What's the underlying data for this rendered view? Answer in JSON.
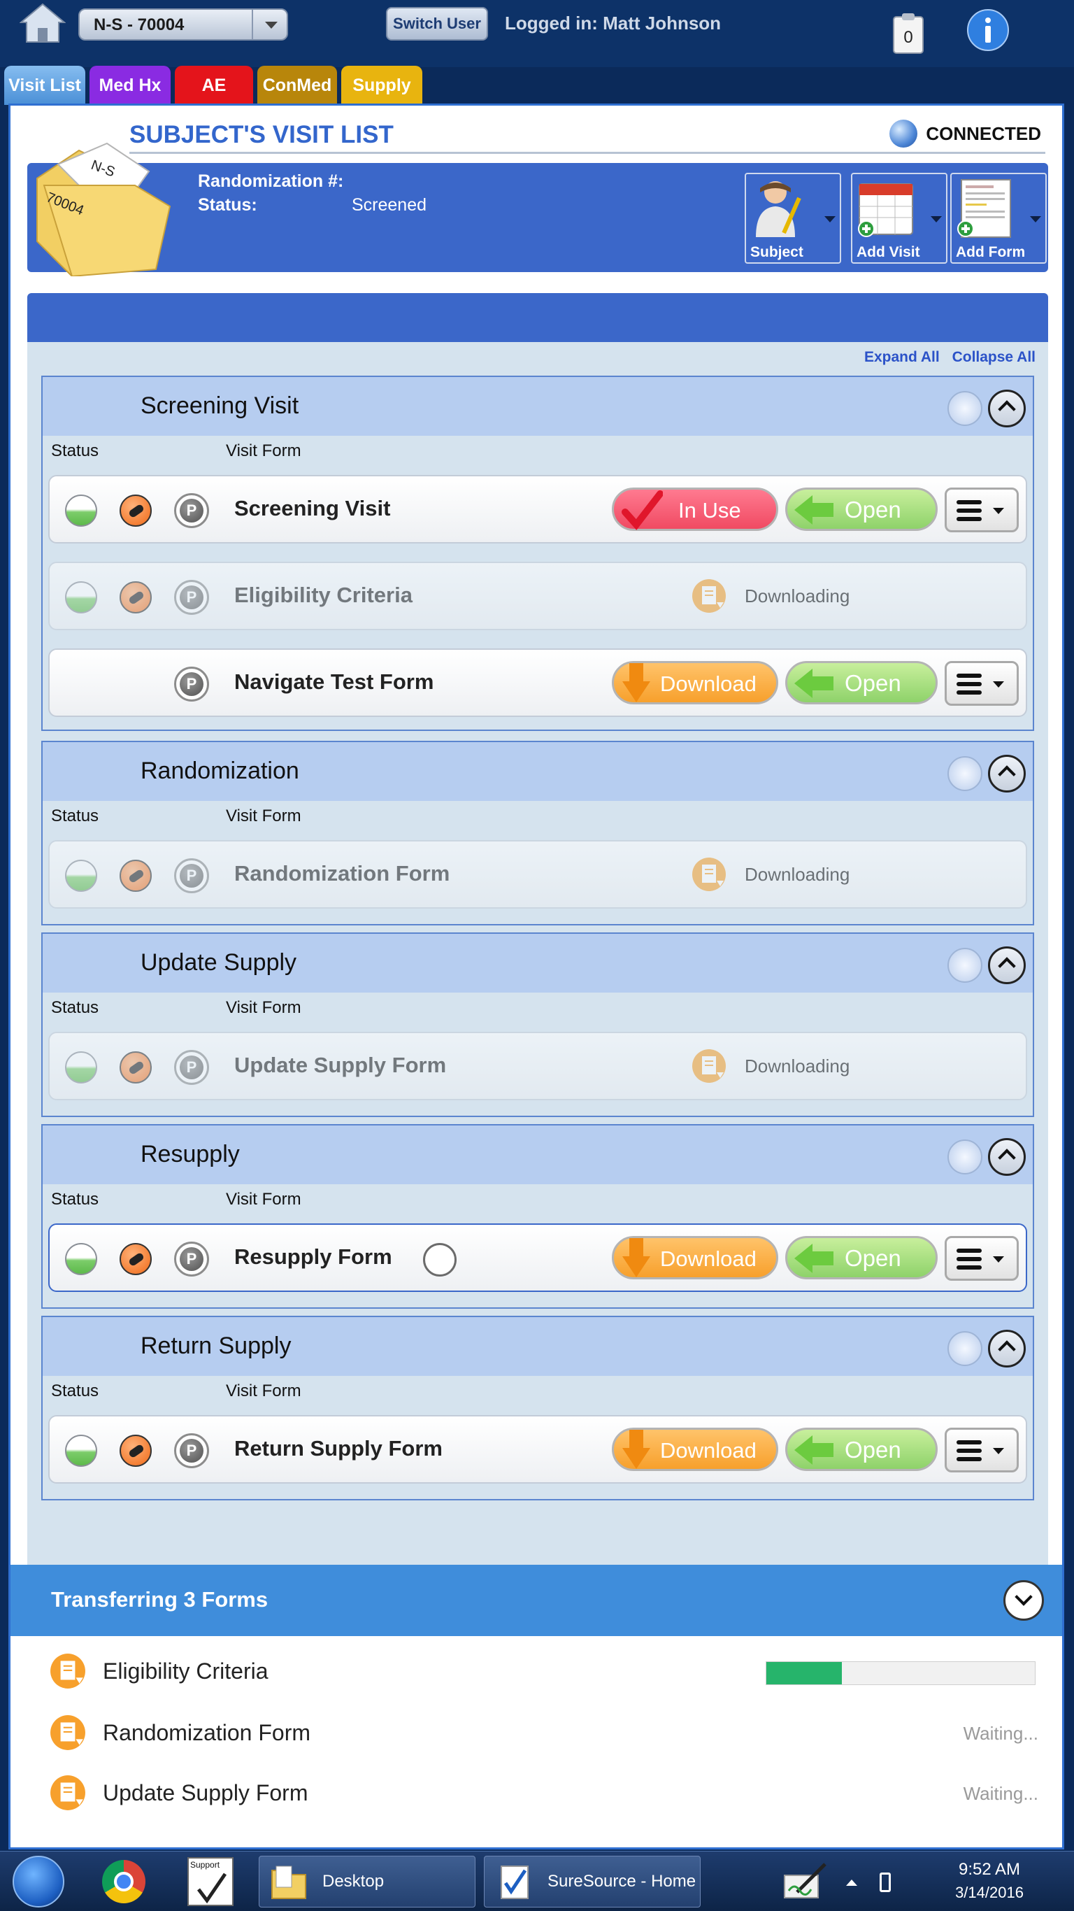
{
  "topbar": {
    "subject_id": "N-S - 70004",
    "switch_user_label": "Switch User",
    "logged_in_text": "Logged in: Matt Johnson",
    "clipboard_count": "0"
  },
  "tabs": [
    {
      "label": "Visit List"
    },
    {
      "label": "Med Hx"
    },
    {
      "label": "AE"
    },
    {
      "label": "ConMed"
    },
    {
      "label": "Supply"
    }
  ],
  "header": {
    "title": "SUBJECT'S VISIT LIST",
    "connection_status": "CONNECTED",
    "folder_label_1": "N-S",
    "folder_label_2": "70004",
    "randomization_label": "Randomization #:",
    "randomization_value": "",
    "status_label": "Status:",
    "status_value": "Screened",
    "toolbar": {
      "subject_label": "Subject",
      "add_visit_label": "Add Visit",
      "add_form_label": "Add Form"
    }
  },
  "list": {
    "expand_all": "Expand All",
    "collapse_all": "Collapse All",
    "col_status": "Status",
    "col_visit_form": "Visit Form",
    "groups": [
      {
        "title": "Screening Visit",
        "forms": [
          {
            "name": "Screening Visit",
            "state": "in-use",
            "action_label": "In Use",
            "open_label": "Open"
          },
          {
            "name": "Eligibility Criteria",
            "state": "downloading",
            "downloading_label": "Downloading"
          },
          {
            "name": "Navigate Test Form",
            "state": "download",
            "action_label": "Download",
            "open_label": "Open"
          }
        ]
      },
      {
        "title": "Randomization",
        "forms": [
          {
            "name": "Randomization Form",
            "state": "downloading",
            "downloading_label": "Downloading"
          }
        ]
      },
      {
        "title": "Update Supply",
        "forms": [
          {
            "name": "Update Supply Form",
            "state": "downloading",
            "downloading_label": "Downloading"
          }
        ]
      },
      {
        "title": "Resupply",
        "forms": [
          {
            "name": "Resupply Form",
            "state": "download",
            "action_label": "Download",
            "open_label": "Open"
          }
        ]
      },
      {
        "title": "Return Supply",
        "forms": [
          {
            "name": "Return Supply Form",
            "state": "download",
            "action_label": "Download",
            "open_label": "Open"
          }
        ]
      }
    ]
  },
  "transfer": {
    "title": "Transferring 3 Forms",
    "items": [
      {
        "name": "Eligibility Criteria",
        "progress": 0.28,
        "status": ""
      },
      {
        "name": "Randomization Form",
        "progress": 0,
        "status": "Waiting..."
      },
      {
        "name": "Update Supply Form",
        "progress": 0,
        "status": "Waiting..."
      }
    ]
  },
  "taskbar": {
    "support_label": "Support",
    "items": [
      {
        "label": "Desktop"
      },
      {
        "label": "SureSource - Home"
      }
    ],
    "time": "9:52 AM",
    "date": "3/14/2016"
  },
  "colors": {
    "accent_blue": "#3b67c9",
    "tab_medhx": "#8a2be2",
    "tab_ae": "#e4141b",
    "tab_conmed": "#b8860b",
    "tab_supply": "#e8b40f",
    "in_use": "#f04a62",
    "download": "#f7a02c",
    "open": "#8ed26a",
    "progress": "#26b46b"
  }
}
